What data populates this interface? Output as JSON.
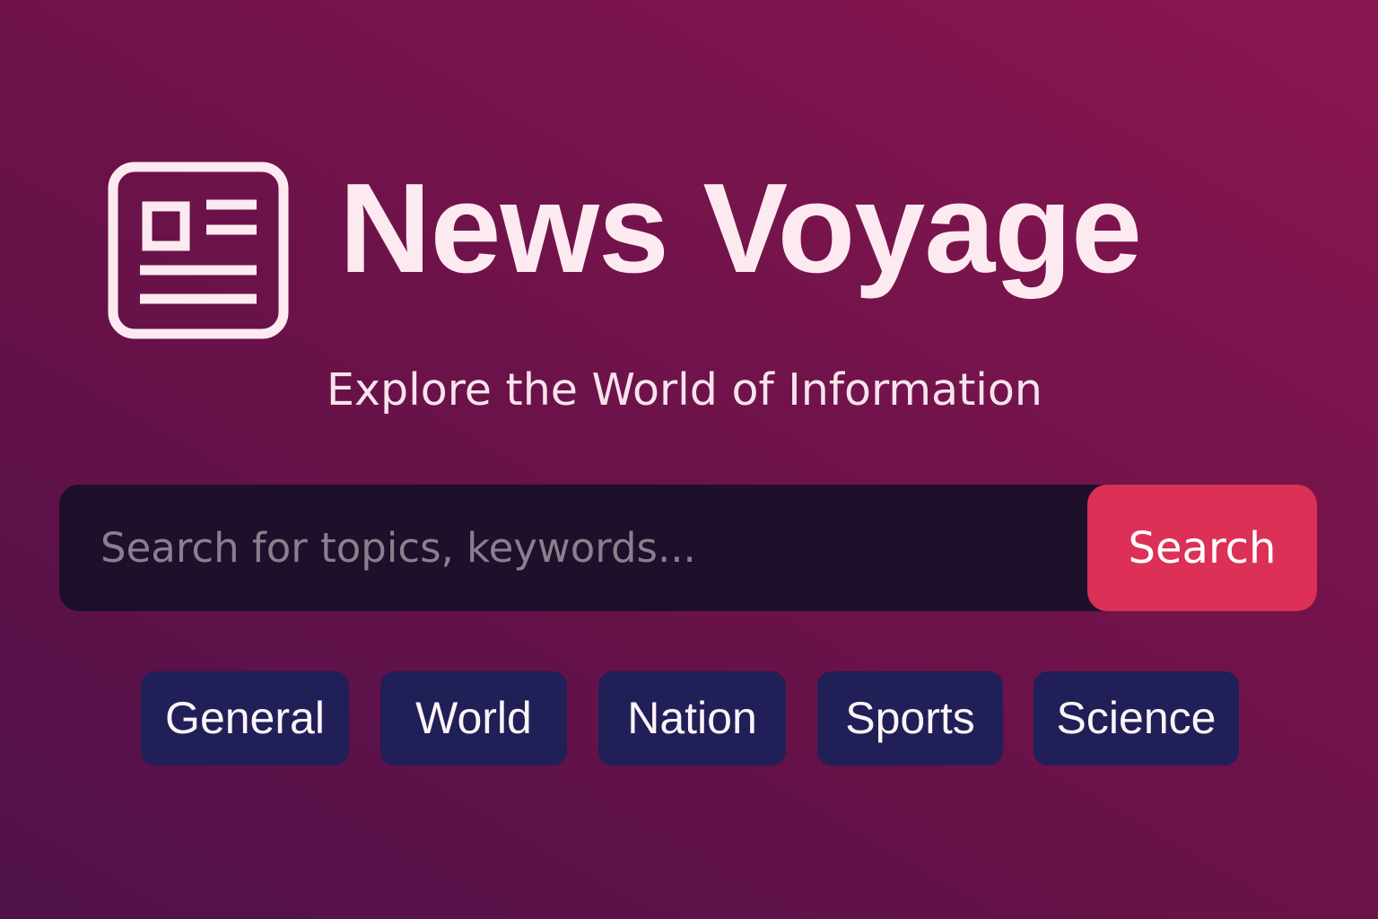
{
  "header": {
    "logo_icon": "newspaper-icon",
    "title": "News Voyage",
    "tagline": "Explore the World of Information"
  },
  "search": {
    "placeholder": "Search for topics, keywords...",
    "value": "",
    "button_label": "Search"
  },
  "categories": [
    {
      "label": "General"
    },
    {
      "label": "World"
    },
    {
      "label": "Nation"
    },
    {
      "label": "Sports"
    },
    {
      "label": "Science"
    }
  ],
  "colors": {
    "background_start": "#4f1249",
    "background_end": "#8a1650",
    "text": "#fdeaf0",
    "search_bar": "#1e0f2b",
    "search_button": "#dc3057",
    "category_chip": "#211f57"
  }
}
